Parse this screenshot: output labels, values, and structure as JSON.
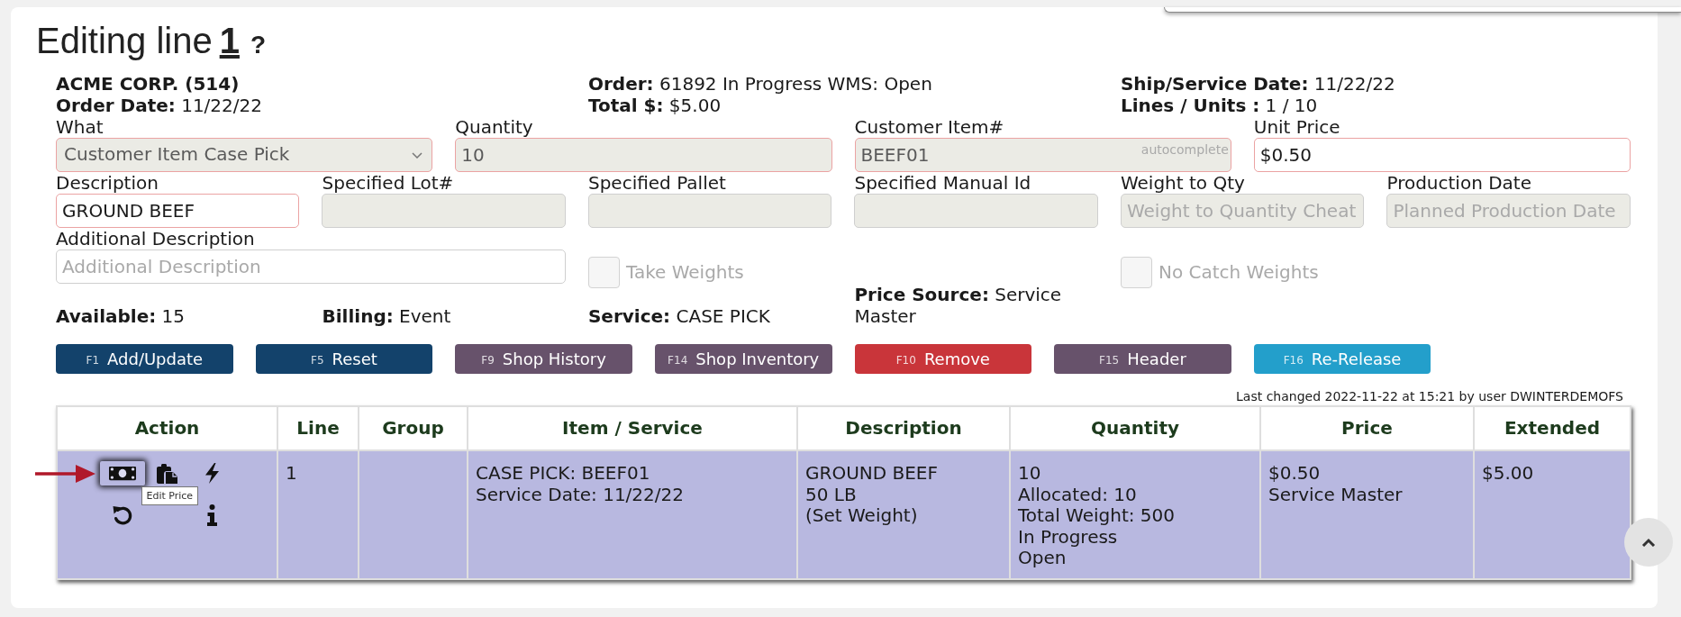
{
  "title": {
    "text": "Editing line",
    "line_number": "1",
    "help": "?"
  },
  "header_info": [
    {
      "title": "ACME CORP. (514)",
      "lines": [
        "**Order Date:** 11/22/22"
      ]
    },
    {
      "lines": [
        "**Order:** 61892 In Progress WMS: Open",
        "**Total $:** $5.00"
      ]
    },
    {
      "lines": [
        "**Ship/Service Date:** 11/22/22",
        "**Lines / Units :** 1 / 10"
      ]
    }
  ],
  "form": {
    "item_fields": [
      {
        "kind": "select",
        "label": "What",
        "value": "Customer Item Case Pick",
        "disabled": true,
        "required": true
      },
      {
        "kind": "text",
        "label": "Quantity",
        "value": "10",
        "disabled": true,
        "required": true
      },
      {
        "kind": "text",
        "label": "Customer Item#",
        "value": "BEEF01",
        "hint": "autocomplete",
        "disabled": true,
        "required": true
      },
      {
        "kind": "text",
        "label": "Unit Price",
        "value": "$0.50",
        "disabled": false,
        "required": true
      }
    ],
    "detail_fields": [
      {
        "kind": "text",
        "label": "Description",
        "value": "GROUND BEEF",
        "disabled": false,
        "required": true
      },
      {
        "kind": "text",
        "label": "Specified Lot#",
        "disabled": true,
        "required": false
      },
      {
        "kind": "text",
        "label": "Specified Pallet",
        "disabled": true,
        "required": false
      },
      {
        "kind": "text",
        "label": "Specified Manual Id",
        "disabled": true,
        "required": false
      },
      {
        "kind": "text",
        "label": "Weight to Qty",
        "placeholder": "Weight to Quantity Cheat",
        "disabled": true,
        "required": false
      },
      {
        "kind": "text",
        "label": "Production Date",
        "placeholder": "Planned Production Date",
        "disabled": true,
        "required": false
      }
    ],
    "extra_fields": [
      {
        "kind": "text",
        "label": "Additional Description",
        "placeholder": "Additional Description",
        "disabled": false,
        "required": false
      },
      {
        "kind": "checkbox",
        "label": "Take Weights",
        "checked": false,
        "disabled": true
      },
      {
        "kind": "checkbox",
        "label": "No Catch Weights",
        "checked": false,
        "disabled": true
      }
    ]
  },
  "summary": [
    "**Available:** 15",
    "**Billing:** Event",
    "**Service:** CASE PICK",
    "**Price Source:** Service Master"
  ],
  "buttons": [
    {
      "key": "F1",
      "label": "Add/Update",
      "color": "#13426b"
    },
    {
      "key": "F5",
      "label": "Reset",
      "color": "#13426b"
    },
    {
      "key": "F9",
      "label": "Shop History",
      "color": "#67526b"
    },
    {
      "key": "F14",
      "label": "Shop Inventory",
      "color": "#67526b"
    },
    {
      "key": "F10",
      "label": "Remove",
      "color": "#c9353a"
    },
    {
      "key": "F15",
      "label": "Header",
      "color": "#67526b"
    },
    {
      "key": "F16",
      "label": "Re-Release",
      "color": "#239fcb"
    }
  ],
  "last_changed": "Last changed 2022-11-22 at 15:21 by user DWINTERDEMOFS",
  "table": {
    "columns": [
      "Action",
      "Line",
      "Group",
      "Item / Service",
      "Description",
      "Quantity",
      "Price",
      "Extended"
    ],
    "rows": [
      {
        "selected": true,
        "actions": [
          [
            {
              "kind": "banknote",
              "hovered": true,
              "tooltip": "Edit Price"
            },
            {
              "kind": "clipboard",
              "hovered": false
            },
            {
              "kind": "bolt",
              "hovered": false
            }
          ],
          [
            {
              "kind": "undo",
              "hovered": false
            },
            {
              "kind": "info",
              "hovered": false
            }
          ]
        ],
        "line": "1",
        "item_service": [
          "CASE PICK: BEEF01",
          "Service Date: 11/22/22"
        ],
        "description": [
          "GROUND BEEF",
          "50 LB",
          "(Set Weight)"
        ],
        "quantity": [
          "10",
          "Allocated: 10",
          "Total Weight: 500",
          "In Progress",
          "Open"
        ],
        "price": [
          "$0.50",
          "Service Master"
        ],
        "extended": "$5.00"
      }
    ]
  }
}
